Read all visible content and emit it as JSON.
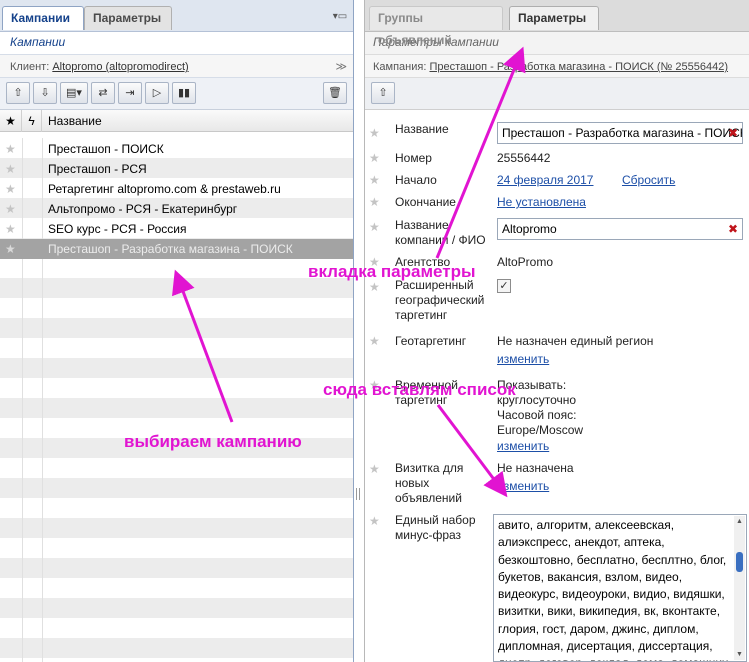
{
  "left": {
    "tabs": {
      "campaigns": "Кампании",
      "params": "Параметры"
    },
    "subtitle": "Кампании",
    "client_label": "Клиент:",
    "client_value": "Altopromo (altopromodirect)",
    "grid": {
      "col_name": "Название",
      "rows": [
        "Престашоп - ПОИСК",
        "Престашоп - РСЯ",
        "Ретаргетинг altopromo.com & prestaweb.ru",
        "Альтопромо - РСЯ - Екатеринбург",
        "SEO курс - РСЯ - Россия",
        "Престашоп - Разработка магазина - ПОИСК"
      ]
    }
  },
  "right": {
    "tabs": {
      "ad_groups": "Группы объявлений",
      "params": "Параметры"
    },
    "subtitle": "Параметры кампании",
    "campaign_label": "Кампания:",
    "campaign_value": "Престашоп - Разработка магазина - ПОИСК (№ 25556442)",
    "fields": {
      "name_label": "Название",
      "name_value": "Престашоп - Разработка магазина - ПОИСК",
      "number_label": "Номер",
      "number_value": "25556442",
      "start_label": "Начало",
      "start_value": "24 февраля 2017",
      "reset_link": "Сбросить",
      "end_label": "Окончание",
      "end_value": "Не установлена",
      "company_label": "Название компании / ФИО",
      "company_value": "Altopromo",
      "agency_label": "Агентство",
      "agency_value": "AltoPromo",
      "geo_ext_label": "Расширенный географический таргетинг",
      "geo_label": "Геотаргетинг",
      "geo_value": "Не назначен единый регион",
      "geo_change": "изменить",
      "time_label": "Временной таргетинг",
      "time_line1": "Показывать:",
      "time_line2": "круглосуточно",
      "time_line3": "Часовой пояс:",
      "time_line4": "Europe/Moscow",
      "time_change": "изменить",
      "vcard_label": "Визитка для новых объявлений",
      "vcard_value": "Не назначена",
      "vcard_change": "изменить",
      "minus_label": "Единый набор минус-фраз",
      "minus_value": "авито, алгоритм, алексеевская, алиэкспресс, анекдот, аптека, безкоштовно, бесплатно, бесплтно, блог, букетов, вакансия, взлом, видео, видеокурс, видеоуроки, видио, видяшки, визитки, вики, википедия, вк, вконтакте, глория, гост, даром, джинс, диплом, дипломная, дисертация, диссертация, днепр, договор, доклад, дома, домашних, драйвер, елены,"
    }
  },
  "annotations": {
    "tab_params": "вкладка параметры",
    "paste_list": "сюда вставлям список",
    "choose_campaign": "выбираем кампанию"
  },
  "colors": {
    "accent": "#15428b",
    "annotation": "#e114d1",
    "link": "#1d4fa7"
  }
}
